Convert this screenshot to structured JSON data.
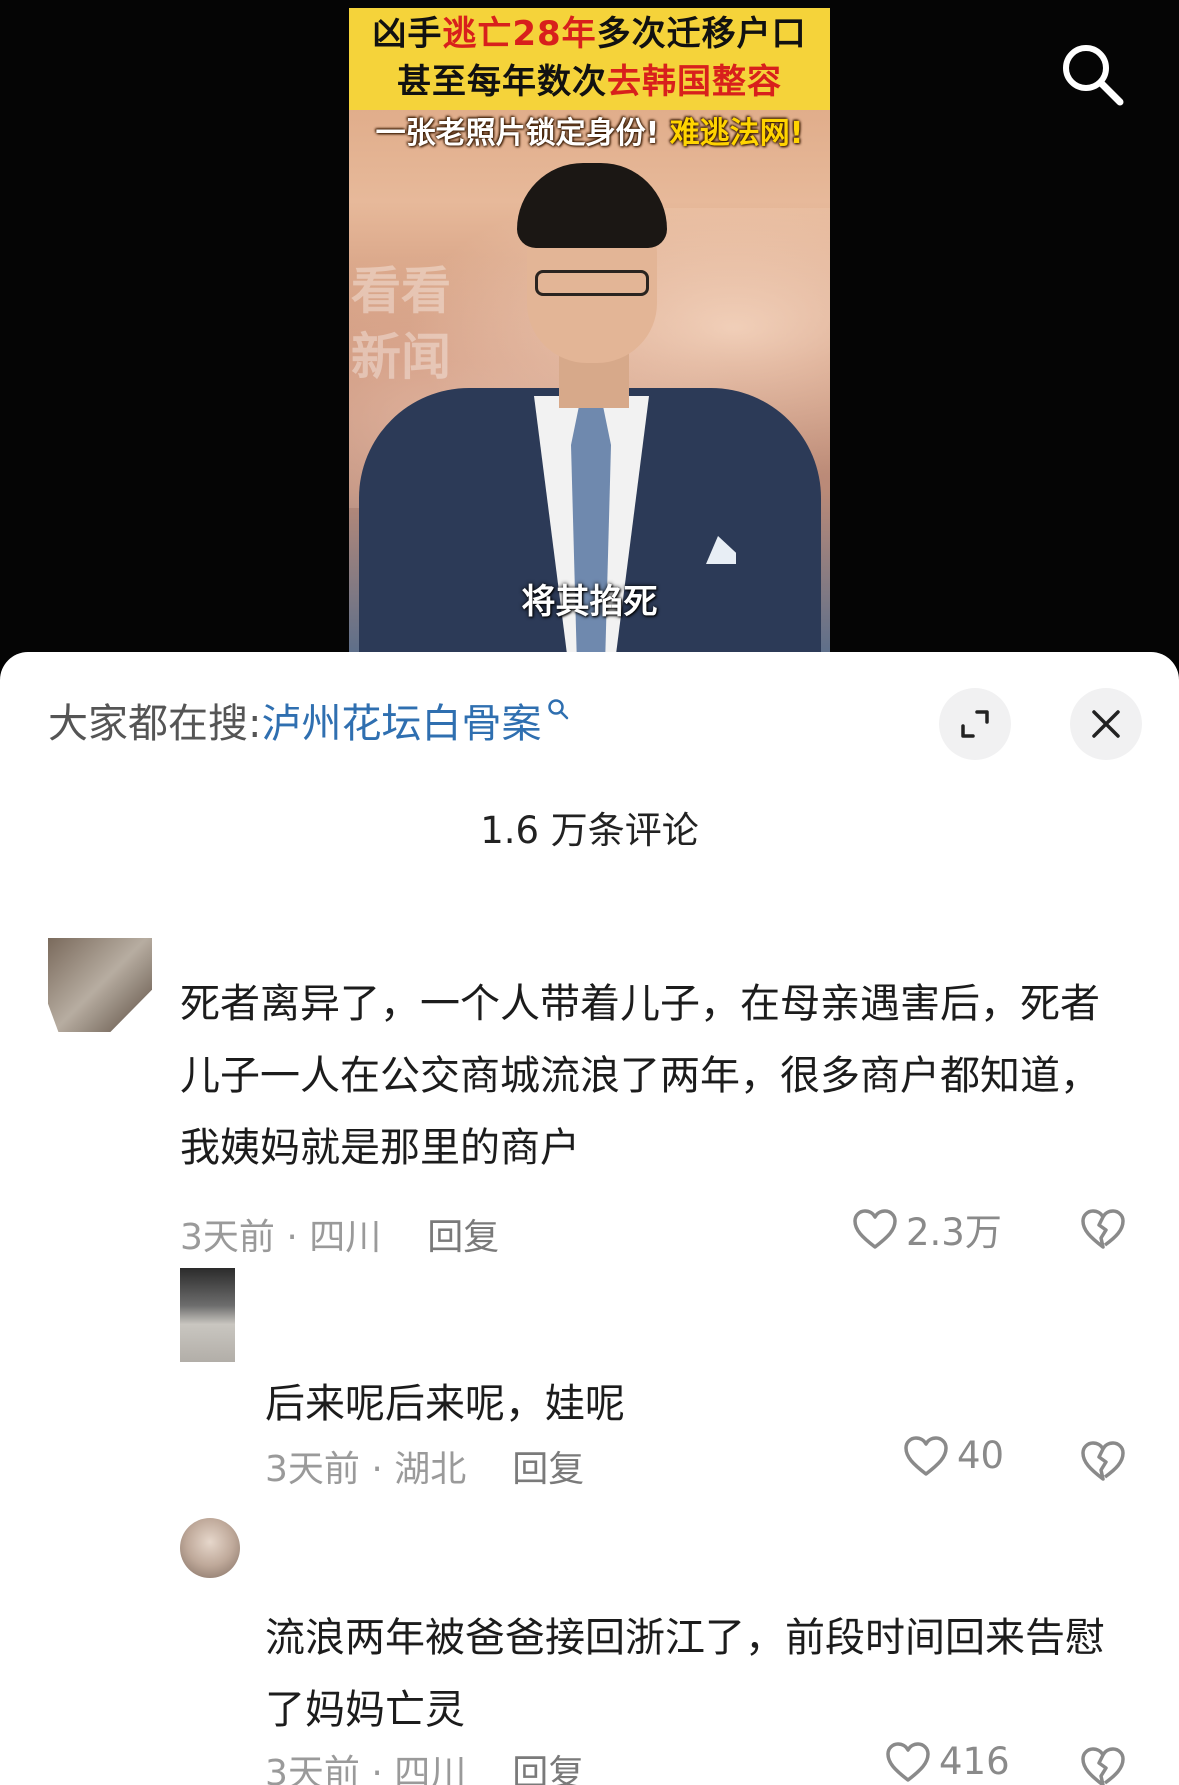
{
  "video": {
    "headline_line1_a": "凶手",
    "headline_line1_b": "逃亡28年",
    "headline_line1_c": "多次迁移户口",
    "headline_line2_a": "甚至每年数次",
    "headline_line2_b": "去韩国整容",
    "subhead_a": "一张老照片锁定身份!",
    "subhead_b": "难逃法网!",
    "watermark": "看看新闻",
    "caption": "将其掐死",
    "search_icon": "search-icon",
    "colors": {
      "headline_band": "#f5d33a",
      "headline_red": "#d8201c",
      "subhead_yellow": "#ffd400"
    }
  },
  "sheet": {
    "search_hint_label": "大家都在搜:",
    "search_hint_term": "泸州花坛白骨案",
    "expand_icon": "expand-icon",
    "close_icon": "close-icon",
    "comment_count": "1.6 万条评论",
    "colors": {
      "link": "#2f6fb0",
      "meta": "#9a9a9a"
    }
  },
  "comments": [
    {
      "text": "死者离异了，一个人带着儿子，在母亲遇害后，死者儿子一人在公交商城流浪了两年，很多商户都知道，我姨妈就是那里的商户",
      "meta": "3天前 · 四川",
      "reply": "回复",
      "likes": "2.3万"
    },
    {
      "text": "后来呢后来呢，娃呢",
      "meta": "3天前 · 湖北",
      "reply": "回复",
      "likes": "40"
    },
    {
      "text": "流浪两年被爸爸接回浙江了，前段时间回来告慰了妈妈亡灵",
      "meta": "3天前 · 四川",
      "reply": "回复",
      "likes": "416"
    }
  ]
}
